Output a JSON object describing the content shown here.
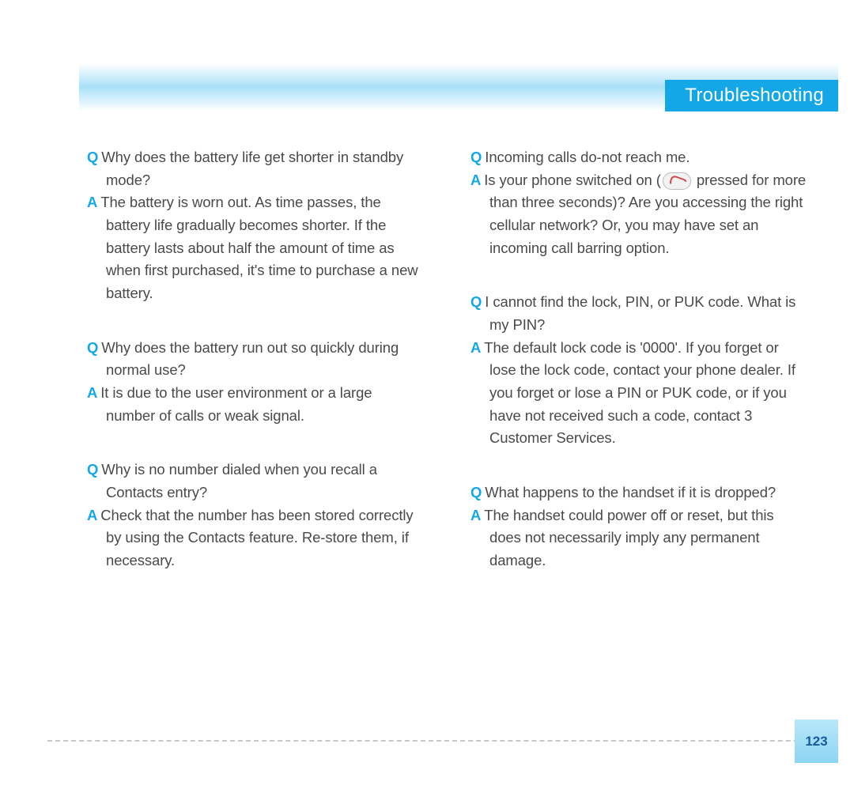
{
  "header": {
    "title": "Troubleshooting"
  },
  "left_column": [
    {
      "q": "Why does the battery life get shorter in standby mode?",
      "a": "The battery is worn out. As time passes, the battery life gradually becomes shorter. If the battery lasts about half the amount of time as when first purchased, it's time to purchase a new battery."
    },
    {
      "q": "Why does the battery run out so quickly during normal use?",
      "a": "It is due to the user environment or a large number of calls or weak signal."
    },
    {
      "q": "Why is no number dialed when you recall a Contacts entry?",
      "a": "Check that the number has been stored correctly by using the Contacts feature. Re-store them, if necessary."
    }
  ],
  "right_column": [
    {
      "q": "Incoming calls do-not reach me.",
      "a_pre": "Is your phone switched on (",
      "a_post": " pressed for more than three seconds)? Are you accessing the right cellular network? Or, you may have set an incoming call barring option.",
      "has_icon": true
    },
    {
      "q": "I cannot find the lock, PIN, or PUK code. What is my PIN?",
      "a": "The default lock code is '0000'. If you forget or lose the lock code, contact your phone dealer. If you forget or lose a PIN or PUK code, or if you have not received such a code, contact 3 Customer Services."
    },
    {
      "q": "What happens to the handset if it is dropped?",
      "a": "The handset could power off or reset, but this does not necessarily imply any permanent damage."
    }
  ],
  "labels": {
    "q": "Q",
    "a": "A"
  },
  "page_number": "123"
}
